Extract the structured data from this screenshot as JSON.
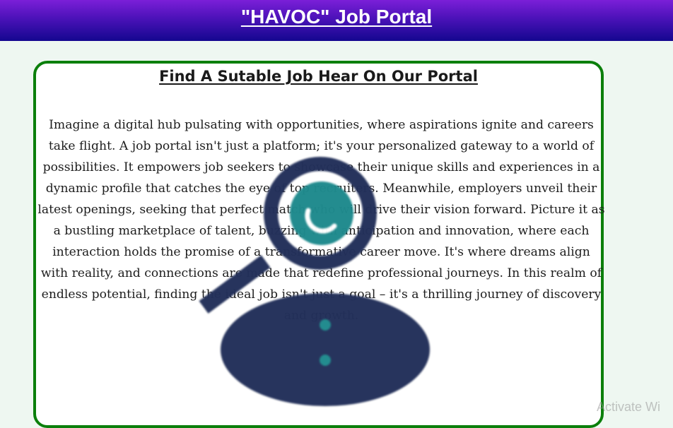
{
  "header": {
    "title": "\"HAVOC\" Job Portal"
  },
  "card": {
    "heading": "Find A Sutable Job Hear On Our Portal",
    "body": "Imagine a digital hub pulsating with opportunities, where aspirations ignite and careers take flight. A job portal isn't just a platform; it's your personalized gateway to a world of possibilities. It empowers job seekers to showcase their unique skills and experiences in a dynamic profile that catches the eye of top recruiters. Meanwhile, employers unveil their latest openings, seeking that perfect match who will drive their vision forward. Picture it as a bustling marketplace of talent, buzzing with anticipation and innovation, where each interaction holds the promise of a transformative career move. It's where dreams align with reality, and connections are made that redefine professional journeys. In this realm of endless potential, finding the ideal job isn't just a goal – it's a thrilling journey of discovery and growth."
  },
  "illustration": {
    "icon": "job-search-person-magnifier-icon",
    "colors": {
      "navy": "#23305a",
      "teal": "#1f8a8d"
    }
  },
  "watermark": {
    "text": "Activate Wi"
  },
  "colors": {
    "header_top": "#7b1fd8",
    "header_bottom": "#14078f",
    "card_border": "#0b7f0b",
    "page_background": "#eef7f1"
  }
}
